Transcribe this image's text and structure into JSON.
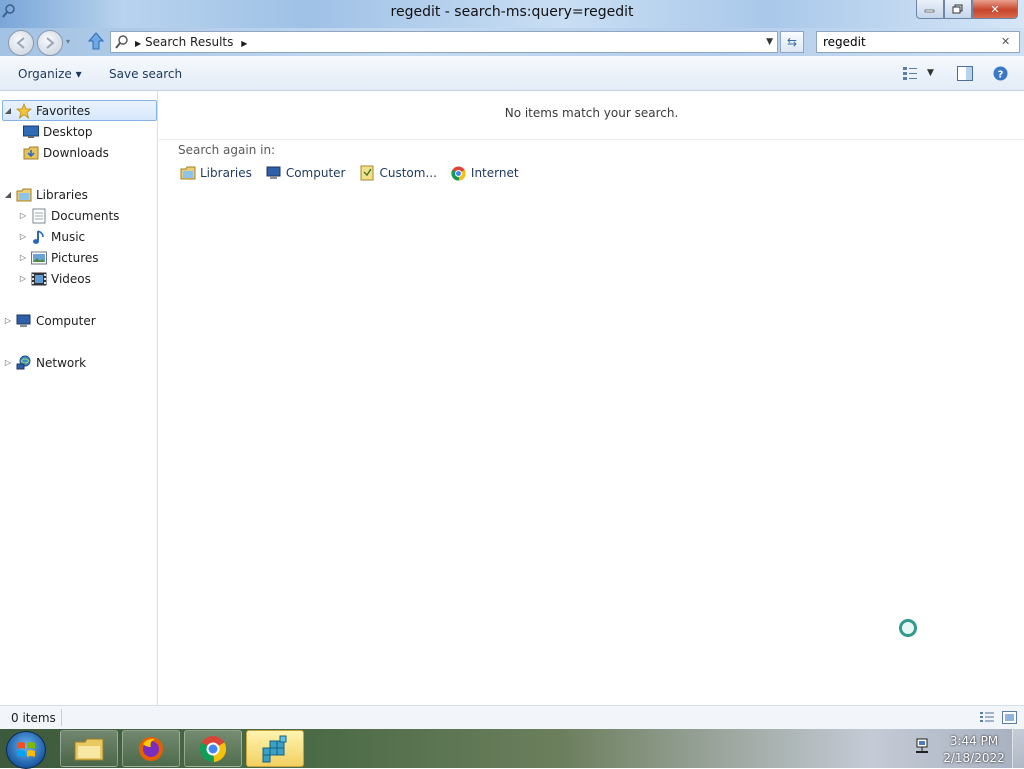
{
  "window": {
    "title": "regedit - search-ms:query=regedit",
    "minimize_label": "—",
    "maximize_label": "□",
    "close_label": "✕"
  },
  "navigation": {
    "back_icon": "back-arrow",
    "forward_icon": "forward-arrow",
    "up_icon": "up-arrow",
    "breadcrumb": [
      "Search Results"
    ],
    "search_value": "regedit"
  },
  "commandbar": {
    "organize_label": "Organize ▾",
    "save_search_label": "Save search"
  },
  "tree": {
    "favorites": {
      "label": "Favorites",
      "children": [
        "Desktop",
        "Downloads"
      ]
    },
    "libraries": {
      "label": "Libraries",
      "children": [
        "Documents",
        "Music",
        "Pictures",
        "Videos"
      ]
    },
    "computer": {
      "label": "Computer"
    },
    "network": {
      "label": "Network"
    }
  },
  "content": {
    "empty_message": "No items match your search.",
    "search_again_label": "Search again in:",
    "search_again_options": [
      "Libraries",
      "Computer",
      "Custom...",
      "Internet"
    ]
  },
  "statusbar": {
    "item_count": "0 items"
  },
  "taskbar": {
    "time": "3:44 PM",
    "date": "2/18/2022",
    "apps": [
      "windows-explorer",
      "firefox",
      "chrome",
      "registry-editor"
    ]
  },
  "colors": {
    "accent": "#1e395b",
    "selection_border": "#86b3e4",
    "close_button": "#c8452b"
  }
}
